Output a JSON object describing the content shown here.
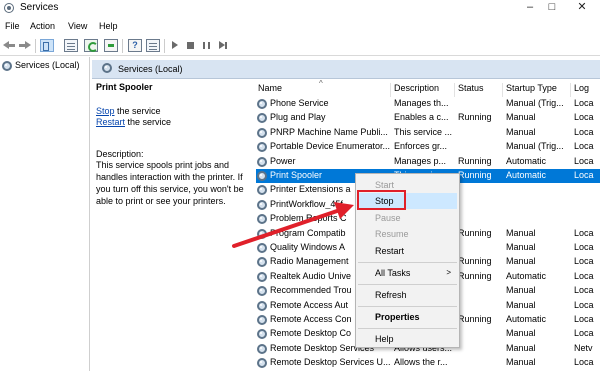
{
  "window": {
    "title": "Services"
  },
  "menu": [
    "File",
    "Action",
    "View",
    "Help"
  ],
  "tree": {
    "root_label": "Services (Local)"
  },
  "panel": {
    "title": "Services (Local)"
  },
  "description_pane": {
    "service_name": "Print Spooler",
    "stop_link": "Stop",
    "stop_suffix": " the service",
    "restart_link": "Restart",
    "restart_suffix": " the service",
    "label": "Description:",
    "text": "This service spools print jobs and handles interaction with the printer. If you turn off this service, you won't be able to print or see your printers."
  },
  "columns": [
    "Name",
    "Description",
    "Status",
    "Startup Type",
    "Log"
  ],
  "rows": [
    {
      "name": "Phone Service",
      "desc": "Manages th...",
      "status": "",
      "startup": "Manual (Trig...",
      "log": "Loca"
    },
    {
      "name": "Plug and Play",
      "desc": "Enables a c...",
      "status": "Running",
      "startup": "Manual",
      "log": "Loca"
    },
    {
      "name": "PNRP Machine Name Publi...",
      "desc": "This service ...",
      "status": "",
      "startup": "Manual",
      "log": "Loca"
    },
    {
      "name": "Portable Device Enumerator...",
      "desc": "Enforces gr...",
      "status": "",
      "startup": "Manual (Trig...",
      "log": "Loca"
    },
    {
      "name": "Power",
      "desc": "Manages p...",
      "status": "Running",
      "startup": "Automatic",
      "log": "Loca"
    },
    {
      "name": "Print Spooler",
      "desc": "This service...",
      "status": "Running",
      "startup": "Automatic",
      "log": "Loca"
    },
    {
      "name": "Printer Extensions a",
      "desc": "",
      "status": "",
      "startup": "",
      "log": ""
    },
    {
      "name": "PrintWorkflow_45f",
      "desc": "",
      "status": "",
      "startup": "",
      "log": ""
    },
    {
      "name": "Problem Reports C",
      "desc": "",
      "status": "",
      "startup": "",
      "log": ""
    },
    {
      "name": "Program Compatib",
      "desc": "",
      "status": "Running",
      "startup": "Manual",
      "log": "Loca"
    },
    {
      "name": "Quality Windows A",
      "desc": "",
      "status": "",
      "startup": "Manual",
      "log": "Loca"
    },
    {
      "name": "Radio Management",
      "desc": "",
      "status": "Running",
      "startup": "Manual",
      "log": "Loca"
    },
    {
      "name": "Realtek Audio Unive",
      "desc": "",
      "status": "Running",
      "startup": "Automatic",
      "log": "Loca"
    },
    {
      "name": "Recommended Trou",
      "desc": "",
      "status": "",
      "startup": "Manual",
      "log": "Loca"
    },
    {
      "name": "Remote Access Aut",
      "desc": "",
      "status": "",
      "startup": "Manual",
      "log": "Loca"
    },
    {
      "name": "Remote Access Con",
      "desc": "",
      "status": "Running",
      "startup": "Automatic",
      "log": "Loca"
    },
    {
      "name": "Remote Desktop Co",
      "desc": "",
      "status": "",
      "startup": "Manual",
      "log": "Loca"
    },
    {
      "name": "Remote Desktop Services",
      "desc": "Allows users...",
      "status": "",
      "startup": "Manual",
      "log": "Netv"
    },
    {
      "name": "Remote Desktop Services U...",
      "desc": "Allows the r...",
      "status": "",
      "startup": "Manual",
      "log": "Loca"
    }
  ],
  "context_menu": {
    "items": [
      "Start",
      "Stop",
      "Pause",
      "Resume",
      "Restart",
      "All Tasks",
      "Refresh",
      "Properties",
      "Help"
    ]
  },
  "colors": {
    "selection": "#0078d7",
    "header_band": "#d8e4f2",
    "menu_hover": "#cde8ff",
    "highlight_box": "#e0202a",
    "annotation_arrow": "#e0202a"
  }
}
